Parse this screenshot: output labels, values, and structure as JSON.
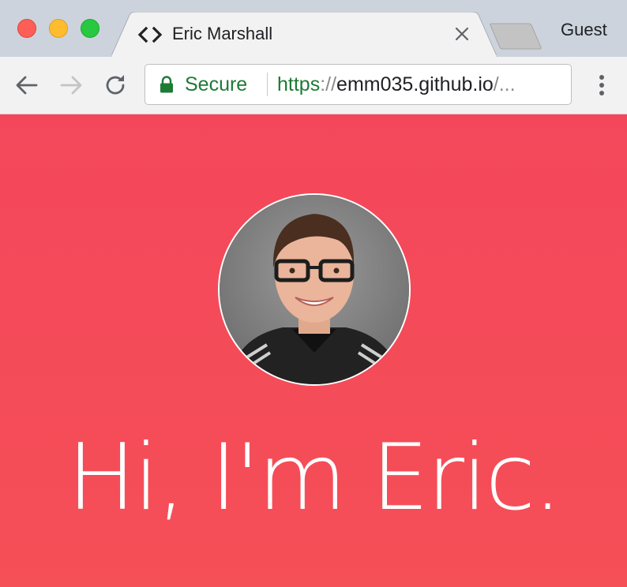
{
  "browser": {
    "tab": {
      "title": "Eric Marshall",
      "favicon": "code-brackets-icon",
      "close_icon": "close-icon"
    },
    "profile_label": "Guest",
    "nav": {
      "back_icon": "arrow-left-icon",
      "forward_icon": "arrow-right-icon",
      "reload_icon": "reload-icon",
      "menu_icon": "kebab-menu-icon"
    },
    "omnibox": {
      "security_icon": "lock-icon",
      "security_label": "Secure",
      "url_scheme": "https",
      "url_separator": "://",
      "url_host": "emm035.github.io",
      "url_rest": "/..."
    }
  },
  "page": {
    "avatar_alt": "avatar",
    "heading": "Hi, I'm Eric."
  },
  "colors": {
    "page_background": "#f24a5a",
    "secure_green": "#1e7a35",
    "tabstrip": "#ccd3dc",
    "toolbar": "#f2f2f2"
  }
}
